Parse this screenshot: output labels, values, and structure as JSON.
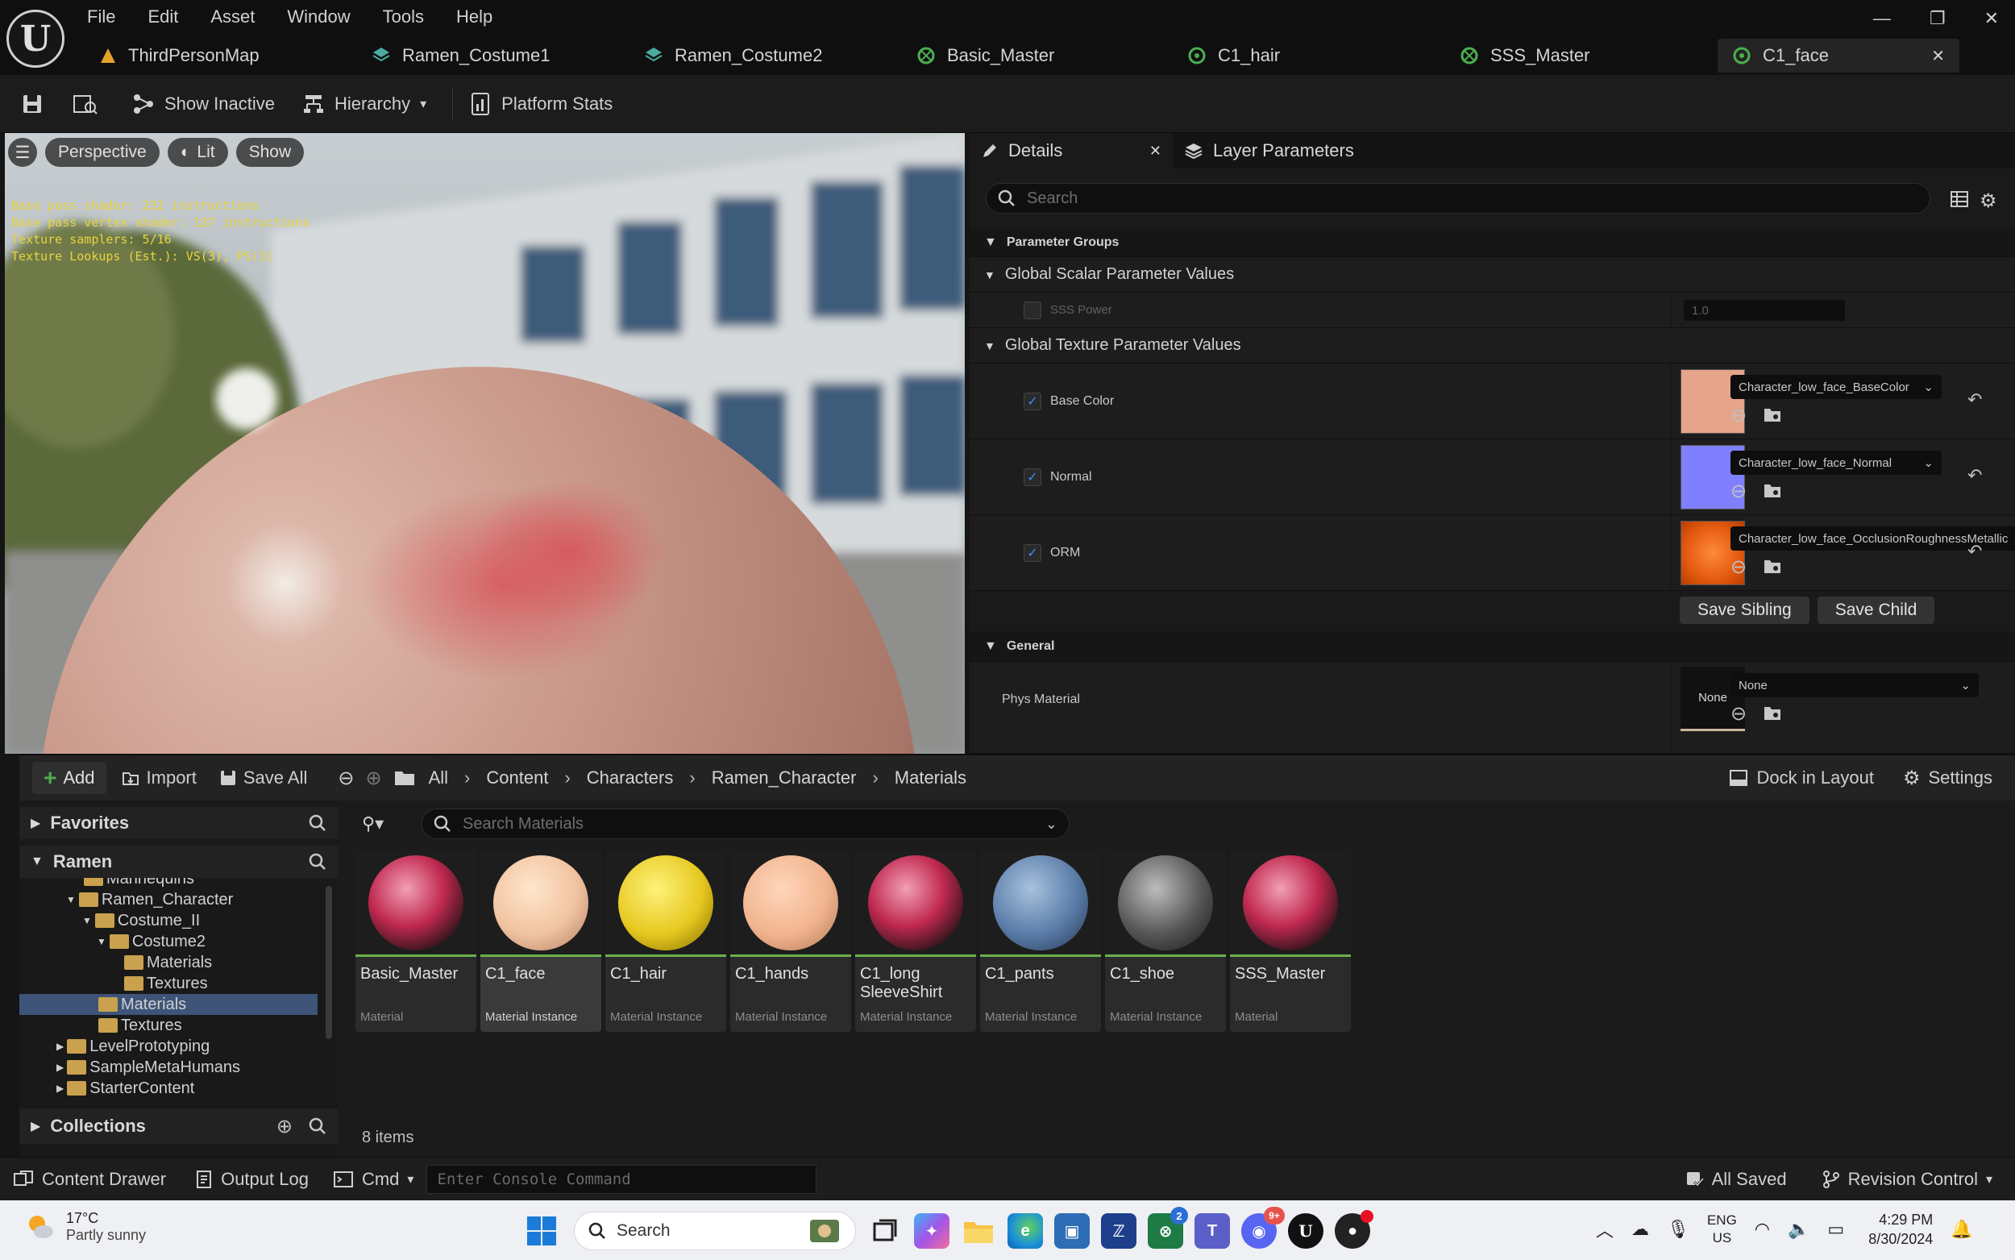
{
  "menu": [
    "File",
    "Edit",
    "Asset",
    "Window",
    "Tools",
    "Help"
  ],
  "tabs": [
    {
      "label": "ThirdPersonMap",
      "icon": "map-icon",
      "color": "#e3a32b"
    },
    {
      "label": "Ramen_Costume1",
      "icon": "material-instance-icon",
      "color": "#4caaa0"
    },
    {
      "label": "Ramen_Costume2",
      "icon": "material-instance-icon",
      "color": "#4caaa0"
    },
    {
      "label": "Basic_Master",
      "icon": "material-icon",
      "color": "#4caf50"
    },
    {
      "label": "C1_hair",
      "icon": "material-instance-icon",
      "color": "#4caf50"
    },
    {
      "label": "SSS_Master",
      "icon": "material-icon",
      "color": "#4caf50"
    },
    {
      "label": "C1_face",
      "icon": "material-instance-icon",
      "color": "#4caf50"
    }
  ],
  "window_controls": {
    "minimize": "—",
    "maximize": "❐",
    "close": "✕"
  },
  "toolbar": {
    "show_inactive": "Show Inactive",
    "hierarchy": "Hierarchy",
    "platform_stats": "Platform Stats"
  },
  "viewport": {
    "perspective": "Perspective",
    "lit": "Lit",
    "show": "Show",
    "stats": [
      "Base pass shader: 232 instructions",
      "Base pass vertex shader: 137 instructions",
      "Texture samplers: 5/16",
      "Texture Lookups (Est.): VS(3), PS(3)"
    ]
  },
  "details": {
    "tab_details": "Details",
    "tab_layer": "Layer Parameters",
    "search_placeholder": "Search",
    "parameter_groups": "Parameter Groups",
    "global_scalar": "Global Scalar Parameter Values",
    "sss_power_label": "SSS Power",
    "sss_power_value": "1.0",
    "global_texture": "Global Texture Parameter Values",
    "textures": [
      {
        "label": "Base Color",
        "asset": "Character_low_face_BaseColor",
        "swatch": "#e6a48a"
      },
      {
        "label": "Normal",
        "asset": "Character_low_face_Normal",
        "swatch": "#8080ff"
      },
      {
        "label": "ORM",
        "asset": "Character_low_face_OcclusionRoughnessMetallic",
        "swatch": "#f26a1c"
      }
    ],
    "save_sibling": "Save Sibling",
    "save_child": "Save Child",
    "general": "General",
    "phys_material_label": "Phys Material",
    "phys_material_thumb": "None",
    "phys_material_value": "None"
  },
  "content_browser": {
    "add": "Add",
    "import": "Import",
    "save_all": "Save All",
    "breadcrumb": [
      "All",
      "Content",
      "Characters",
      "Ramen_Character",
      "Materials"
    ],
    "dock_in_layout": "Dock in Layout",
    "settings": "Settings",
    "favorites": "Favorites",
    "project": "Ramen",
    "search_placeholder": "Search Materials",
    "tree": [
      {
        "label": "Mannequins",
        "indent": 1,
        "selected": false
      },
      {
        "label": "Ramen_Character",
        "indent": 1,
        "selected": false
      },
      {
        "label": "Costume_II",
        "indent": 2,
        "selected": false
      },
      {
        "label": "Costume2",
        "indent": 3,
        "selected": false
      },
      {
        "label": "Materials",
        "indent": 4,
        "selected": false
      },
      {
        "label": "Textures",
        "indent": 4,
        "selected": false
      },
      {
        "label": "Materials",
        "indent": 3,
        "selected": true
      },
      {
        "label": "Textures",
        "indent": 3,
        "selected": false
      },
      {
        "label": "LevelPrototyping",
        "indent": 1,
        "selected": false
      },
      {
        "label": "SampleMetaHumans",
        "indent": 1,
        "selected": false
      },
      {
        "label": "StarterContent",
        "indent": 1,
        "selected": false
      }
    ],
    "collections": "Collections",
    "item_count": "8 items",
    "assets": [
      {
        "name": "Basic_Master",
        "type": "Material",
        "ball": "radial-gradient(circle at 40% 35%, #f2a0b4, #c02850 45%, #2a1418 80%)"
      },
      {
        "name": "C1_face",
        "type": "Material Instance",
        "ball": "radial-gradient(circle at 40% 35%, #ffe6cc, #f0c3a0 55%, #b7836a 95%)"
      },
      {
        "name": "C1_hair",
        "type": "Material Instance",
        "ball": "radial-gradient(circle at 40% 35%, #fff27a, #e6c820 55%, #8a7200 95%)"
      },
      {
        "name": "C1_hands",
        "type": "Material Instance",
        "ball": "radial-gradient(circle at 40% 35%, #ffd6bb, #f1b48e 55%, #b57c5c 95%)"
      },
      {
        "name": "C1_long SleeveShirt",
        "type": "Material Instance",
        "ball": "radial-gradient(circle at 40% 35%, #f2a0b4, #c02850 45%, #2a1418 80%)"
      },
      {
        "name": "C1_pants",
        "type": "Material Instance",
        "ball": "radial-gradient(circle at 40% 35%, #a8c2de, #5a7ca8 55%, #2a3e5c 95%)"
      },
      {
        "name": "C1_shoe",
        "type": "Material Instance",
        "ball": "radial-gradient(circle at 40% 35%, #bdbdbd, #555 55%, #1e1e1e 95%)"
      },
      {
        "name": "SSS_Master",
        "type": "Material",
        "ball": "radial-gradient(circle at 40% 35%, #f2a0b4, #c02850 45%, #2a1418 80%)"
      }
    ]
  },
  "status": {
    "content_drawer": "Content Drawer",
    "output_log": "Output Log",
    "cmd": "Cmd",
    "console_placeholder": "Enter Console Command",
    "all_saved": "All Saved",
    "revision_control": "Revision Control"
  },
  "taskbar": {
    "temp": "17°C",
    "weather": "Partly sunny",
    "search": "Search",
    "lang1": "ENG",
    "lang2": "US",
    "time": "4:29 PM",
    "date": "8/30/2024",
    "teams_badge": "2",
    "discord_badge": "9+"
  }
}
